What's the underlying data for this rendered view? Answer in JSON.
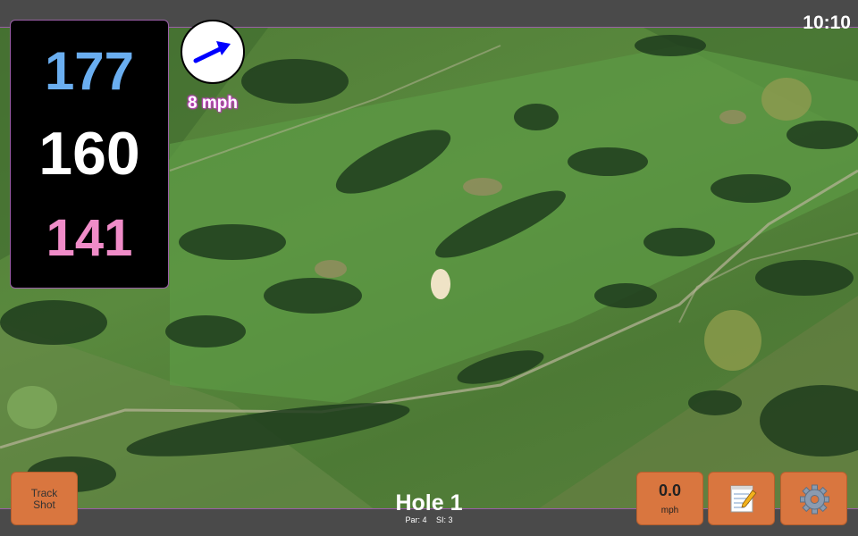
{
  "status": {
    "clock": "10:10"
  },
  "distances": {
    "back": "177",
    "middle": "160",
    "front": "141"
  },
  "wind": {
    "speed_label": "8 mph",
    "icon": "wind-arrow-icon"
  },
  "hole": {
    "title": "Hole 1",
    "par_label": "Par: 4",
    "si_label": "SI: 3"
  },
  "buttons": {
    "track_shot_line1": "Track",
    "track_shot_line2": "Shot",
    "speed_value": "0.0",
    "speed_unit": "mph",
    "notes_icon": "notepad-icon",
    "settings_icon": "gear-icon"
  },
  "colors": {
    "back": "#6aaef0",
    "middle": "#ffffff",
    "front": "#f08cc8",
    "button": "#d9763f",
    "wind_arrow": "#0000ff"
  }
}
